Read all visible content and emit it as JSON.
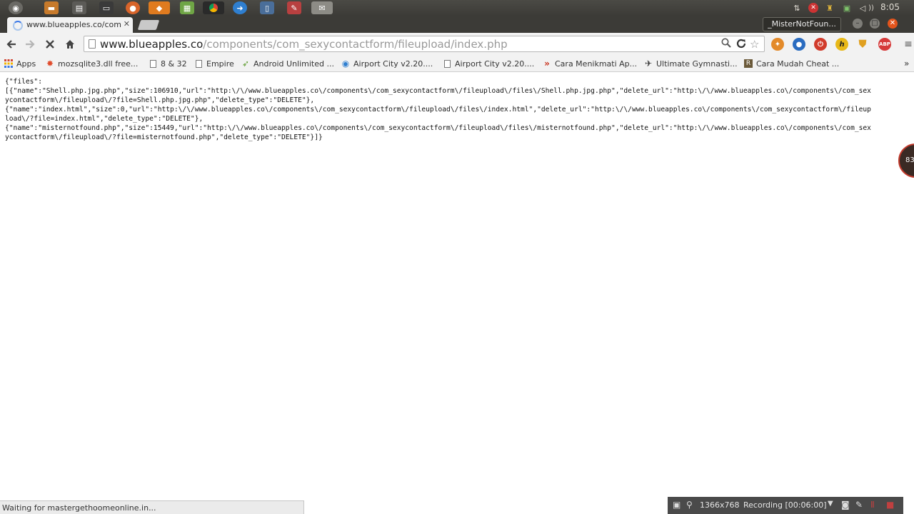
{
  "os_panel": {
    "clock": "8:05",
    "launchers": [
      {
        "icon": "dash-icon",
        "color": "#6b6a65"
      },
      {
        "icon": "files-folder-icon",
        "color": "#c77a2b"
      },
      {
        "icon": "text-editor-icon",
        "color": "#5c5b57"
      },
      {
        "icon": "terminal-icon",
        "color": "#3a3a3a"
      },
      {
        "icon": "firefox-icon",
        "color": "#d8642a"
      },
      {
        "icon": "app-orange-icon",
        "color": "#e07b1f"
      },
      {
        "icon": "spreadsheet-icon",
        "color": "#6fa545"
      },
      {
        "icon": "chrome-icon",
        "color": "#444444"
      },
      {
        "icon": "browser-blue-icon",
        "color": "#2f7fd0"
      },
      {
        "icon": "notes-icon",
        "color": "#4a6e9a"
      },
      {
        "icon": "app-red-icon",
        "color": "#b84040"
      },
      {
        "icon": "image-viewer-icon",
        "color": "#8d8c86"
      }
    ]
  },
  "browser": {
    "tab_title": "www.blueapples.co/com",
    "profile": "_MisterNotFoun...",
    "url_host": "www.blueapples.co",
    "url_path": "/components/com_sexycontactform/fileupload/index.php"
  },
  "bookmarks": [
    {
      "label": "Apps",
      "icon": "apps-grid-icon"
    },
    {
      "label": "mozsqlite3.dll free...",
      "icon": "puzzle-icon"
    },
    {
      "label": "8 & 32",
      "icon": "page-icon"
    },
    {
      "label": "Empire",
      "icon": "page-icon"
    },
    {
      "label": "Android Unlimited ...",
      "icon": "leaf-icon"
    },
    {
      "label": "Airport City v2.20....",
      "icon": "plane-icon"
    },
    {
      "label": "Airport City v2.20....",
      "icon": "page-icon"
    },
    {
      "label": "Cara Menikmati Ap...",
      "icon": "chevrons-icon"
    },
    {
      "label": "Ultimate Gymnasti...",
      "icon": "gymnast-icon"
    },
    {
      "label": "Cara Mudah Cheat ...",
      "icon": "r-logo-icon"
    }
  ],
  "page": {
    "lines": [
      "{\"files\":",
      "[{\"name\":\"Shell.php.jpg.php\",\"size\":106910,\"url\":\"http:\\/\\/www.blueapples.co\\/components\\/com_sexycontactform\\/fileupload\\/files\\/Shell.php.jpg.php\",\"delete_url\":\"http:\\/\\/www.blueapples.co\\/components\\/com_sex",
      "ycontactform\\/fileupload\\/?file=Shell.php.jpg.php\",\"delete_type\":\"DELETE\"},",
      "{\"name\":\"index.html\",\"size\":0,\"url\":\"http:\\/\\/www.blueapples.co\\/components\\/com_sexycontactform\\/fileupload\\/files\\/index.html\",\"delete_url\":\"http:\\/\\/www.blueapples.co\\/components\\/com_sexycontactform\\/fileup",
      "load\\/?file=index.html\",\"delete_type\":\"DELETE\"},",
      "{\"name\":\"misternotfound.php\",\"size\":15449,\"url\":\"http:\\/\\/www.blueapples.co\\/components\\/com_sexycontactform\\/fileupload\\/files\\/misternotfound.php\",\"delete_url\":\"http:\\/\\/www.blueapples.co\\/components\\/com_sex",
      "ycontactform\\/fileupload\\/?file=misternotfound.php\",\"delete_type\":\"DELETE\"}]}"
    ],
    "side_widget": "83"
  },
  "status": "Waiting for mastergethoomeonline.in...",
  "recorder": {
    "resolution": "1366x768",
    "state": "Recording [00:06:00]"
  }
}
